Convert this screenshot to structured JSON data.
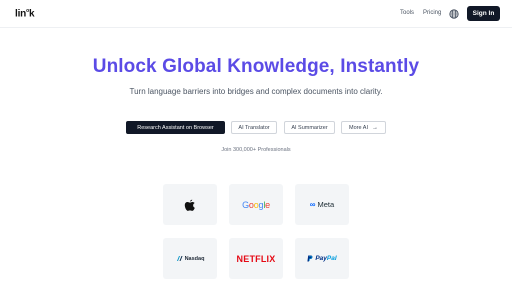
{
  "header": {
    "logo_text": "linok",
    "nav": {
      "tools": "Tools",
      "pricing": "Pricing"
    },
    "globe_icon": "globe-icon",
    "signin_label": "Sign In"
  },
  "hero": {
    "title": "Unlock Global Knowledge, Instantly",
    "subtitle": "Turn language barriers into bridges and complex documents into clarity."
  },
  "chips": [
    {
      "label": "Research Assistant on Browser",
      "active": true
    },
    {
      "label": "AI Translator",
      "active": false
    },
    {
      "label": "AI Summarizer",
      "active": false
    },
    {
      "label": "More AI",
      "active": false,
      "icon": "arrow-right-icon"
    }
  ],
  "social_proof": "Join 300,000+ Professionals",
  "logos": [
    {
      "name": "Apple",
      "icon": "apple-logo"
    },
    {
      "name": "Google"
    },
    {
      "name": "Meta"
    },
    {
      "name": "Nasdaq"
    },
    {
      "name": "NETFLIX"
    },
    {
      "name": "PayPal"
    }
  ],
  "colors": {
    "accent": "#5b4be6",
    "primary_button": "#111827",
    "card_bg": "#f3f5f7"
  }
}
